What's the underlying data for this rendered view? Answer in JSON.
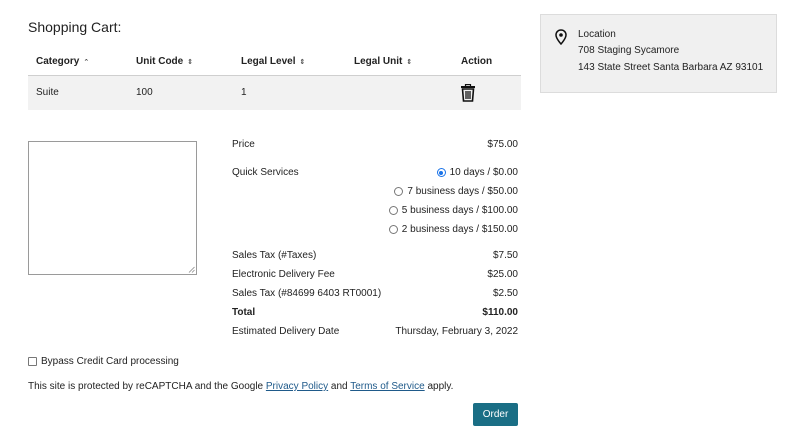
{
  "page": {
    "title": "Shopping Cart:"
  },
  "cart": {
    "headers": {
      "category": "Category",
      "unit_code": "Unit Code",
      "legal_level": "Legal Level",
      "legal_unit": "Legal Unit",
      "action": "Action"
    },
    "sort_icons": {
      "category": "⌃",
      "default": "⇕"
    },
    "rows": [
      {
        "category": "Suite",
        "unit_code": "100",
        "legal_level": "1",
        "legal_unit": "",
        "action_icon": "trash-icon"
      }
    ]
  },
  "location": {
    "icon": "map-pin-icon",
    "label": "Location",
    "line1": "708 Staging Sycamore",
    "line2": "143 State Street Santa Barbara AZ 93101"
  },
  "notes": {
    "value": ""
  },
  "summary": {
    "price_label": "Price",
    "price_value": "$75.00",
    "quick_label": "Quick Services",
    "quick_options": [
      {
        "label": "10 days / $0.00",
        "selected": true
      },
      {
        "label": "7 business days / $50.00",
        "selected": false
      },
      {
        "label": "5 business days / $100.00",
        "selected": false
      },
      {
        "label": "2 business days / $150.00",
        "selected": false
      }
    ],
    "sales_tax_label": "Sales Tax (#Taxes)",
    "sales_tax_value": "$7.50",
    "edelivery_label": "Electronic Delivery Fee",
    "edelivery_value": "$25.00",
    "sales_tax2_label": "Sales Tax (#84699 6403 RT0001)",
    "sales_tax2_value": "$2.50",
    "total_label": "Total",
    "total_value": "$110.00",
    "delivery_label": "Estimated Delivery Date",
    "delivery_value": "Thursday, February 3, 2022"
  },
  "bypass": {
    "label": "Bypass Credit Card processing",
    "checked": false
  },
  "recaptcha": {
    "prefix": "This site is protected by reCAPTCHA and the Google ",
    "privacy": "Privacy Policy",
    "and": " and ",
    "terms": "Terms of Service",
    "suffix": " apply."
  },
  "order_button": {
    "label": "Order"
  },
  "colors": {
    "accent": "#1a6e85",
    "link": "#1f5a8a",
    "radio": "#1a73e8",
    "panel": "#f0f0f0"
  }
}
